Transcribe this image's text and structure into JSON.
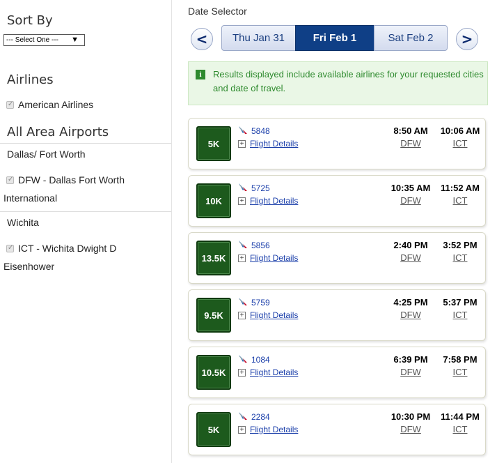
{
  "sidebar": {
    "sort_by": "Sort By",
    "sort_select": "--- Select One ---",
    "airlines_heading": "Airlines",
    "airline": "American Airlines",
    "airports_heading": "All Area Airports",
    "city1": "Dallas/ Fort Worth",
    "airport1_line1": "DFW - Dallas Fort Worth",
    "airport1_line2": "International",
    "city2": "Wichita",
    "airport2_line1": "ICT - Wichita Dwight D",
    "airport2_line2": "Eisenhower"
  },
  "date_selector": {
    "title": "Date Selector",
    "prev": "<",
    "next": ">",
    "dates": [
      "Thu Jan 31",
      "Fri Feb 1",
      "Sat Feb 2"
    ],
    "selected": "Fri Feb 1"
  },
  "info": {
    "icon": "i",
    "text": "Results displayed include available airlines for your requested cities and date of travel."
  },
  "flight_details_label": "Flight Details",
  "flights": [
    {
      "miles": "5K",
      "number": "5848",
      "dep_time": "8:50 AM",
      "arr_time": "10:06 AM",
      "dep_code": "DFW",
      "arr_code": "ICT"
    },
    {
      "miles": "10K",
      "number": "5725",
      "dep_time": "10:35 AM",
      "arr_time": "11:52 AM",
      "dep_code": "DFW",
      "arr_code": "ICT"
    },
    {
      "miles": "13.5K",
      "number": "5856",
      "dep_time": "2:40 PM",
      "arr_time": "3:52 PM",
      "dep_code": "DFW",
      "arr_code": "ICT"
    },
    {
      "miles": "9.5K",
      "number": "5759",
      "dep_time": "4:25 PM",
      "arr_time": "5:37 PM",
      "dep_code": "DFW",
      "arr_code": "ICT"
    },
    {
      "miles": "10.5K",
      "number": "1084",
      "dep_time": "6:39 PM",
      "arr_time": "7:58 PM",
      "dep_code": "DFW",
      "arr_code": "ICT"
    },
    {
      "miles": "5K",
      "number": "2284",
      "dep_time": "10:30 PM",
      "arr_time": "11:44 PM",
      "dep_code": "DFW",
      "arr_code": "ICT"
    }
  ],
  "colors": {
    "accent": "#0f3f86",
    "miles_badge": "#1d5a1d",
    "info_text": "#2e8a2e",
    "link": "#1b3faa"
  }
}
